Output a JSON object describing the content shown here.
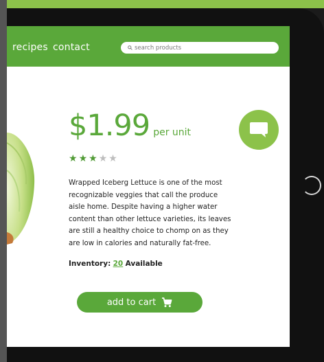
{
  "nav": {
    "links": [
      "recipes",
      "contact"
    ],
    "search_placeholder": "search products"
  },
  "product": {
    "price": "$1.99",
    "price_unit": "per unit",
    "rating": 3,
    "rating_max": 5,
    "description": "Wrapped Iceberg Lettuce is one of the most recognizable veggies that call the produce aisle home. Despite having a higher water content than other lettuce varieties, its leaves are still a healthy choice to chomp on as they are low in calories and naturally fat-free.",
    "inventory_label": "Inventory:",
    "inventory_count": "20",
    "inventory_suffix": "Available"
  },
  "cart": {
    "label": "add to cart"
  },
  "icons": {
    "chat": "chat-bubble-icon",
    "cart": "cart-icon",
    "search": "search-icon",
    "star": "star-icon"
  },
  "colors": {
    "brand_green": "#5aa83a",
    "light_green": "#8cc24a",
    "star_filled": "#4f9a33",
    "star_empty": "#bdbdbd"
  }
}
